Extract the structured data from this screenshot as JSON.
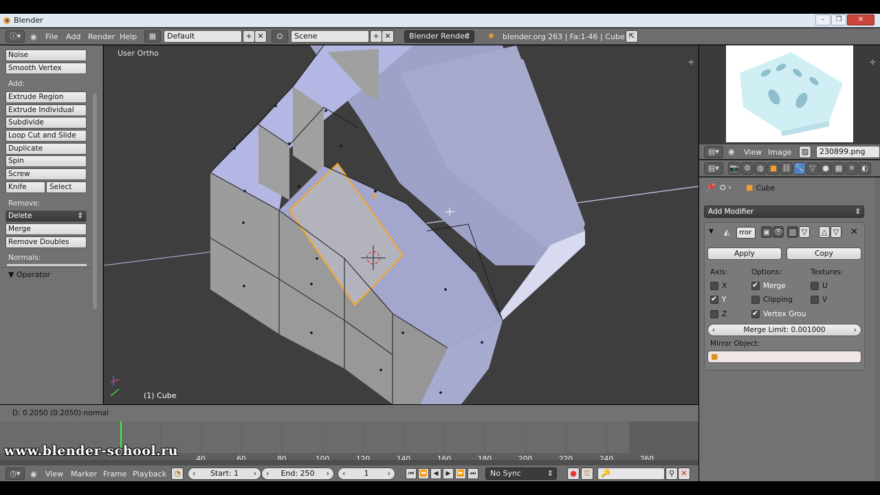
{
  "window": {
    "title": "Blender"
  },
  "topbar": {
    "menus": [
      "File",
      "Add",
      "Render",
      "Help"
    ],
    "layout": "Default",
    "scene": "Scene",
    "engine": "Blender Render",
    "info": "blender.org 263 | Fa:1-46 | Cube"
  },
  "toolshelf": {
    "buttons_top": [
      "Noise",
      "Smooth Vertex"
    ],
    "add_label": "Add:",
    "add_buttons": [
      "Extrude Region",
      "Extrude Individual",
      "Subdivide",
      "Loop Cut and Slide",
      "Duplicate",
      "Spin",
      "Screw"
    ],
    "knife": "Knife",
    "select": "Select",
    "remove_label": "Remove:",
    "delete": "Delete",
    "merge": "Merge",
    "remove_doubles": "Remove Doubles",
    "normals_label": "Normals:",
    "operator_label": "Operator"
  },
  "viewport": {
    "view_name": "User Ortho",
    "object_label": "(1) Cube"
  },
  "status": {
    "text": "D: 0.2050 (0.2050) normal"
  },
  "timeline": {
    "ticks": [
      "40",
      "60",
      "80",
      "100",
      "120",
      "140",
      "160",
      "180",
      "200",
      "220",
      "240",
      "260"
    ],
    "watermark": "www.blender-school.ru",
    "menus": [
      "View",
      "Marker",
      "Frame",
      "Playback"
    ],
    "start": "Start: 1",
    "end": "End: 250",
    "current_frame": "1",
    "sync": "No Sync"
  },
  "image_editor": {
    "menus": [
      "View",
      "Image"
    ],
    "image_name": "230899.png"
  },
  "properties": {
    "object_name": "Cube",
    "add_modifier": "Add Modifier",
    "modifier_name": "rror",
    "apply": "Apply",
    "copy": "Copy",
    "axis_label": "Axis:",
    "options_label": "Options:",
    "textures_label": "Textures:",
    "axis_x": "X",
    "axis_y": "Y",
    "axis_z": "Z",
    "opt_merge": "Merge",
    "opt_clipping": "Clipping",
    "opt_vertex": "Vertex Grou",
    "tex_u": "U",
    "tex_v": "V",
    "merge_limit": "Merge Limit: 0.001000",
    "mirror_object_label": "Mirror Object:",
    "checks": {
      "x": false,
      "y": true,
      "z": false,
      "merge": true,
      "clipping": false,
      "vertex": true,
      "u": false,
      "v": false
    }
  },
  "colors": {
    "selection": "#f5a623",
    "playhead": "#3ff03f",
    "mesh": "#c8cce8"
  }
}
